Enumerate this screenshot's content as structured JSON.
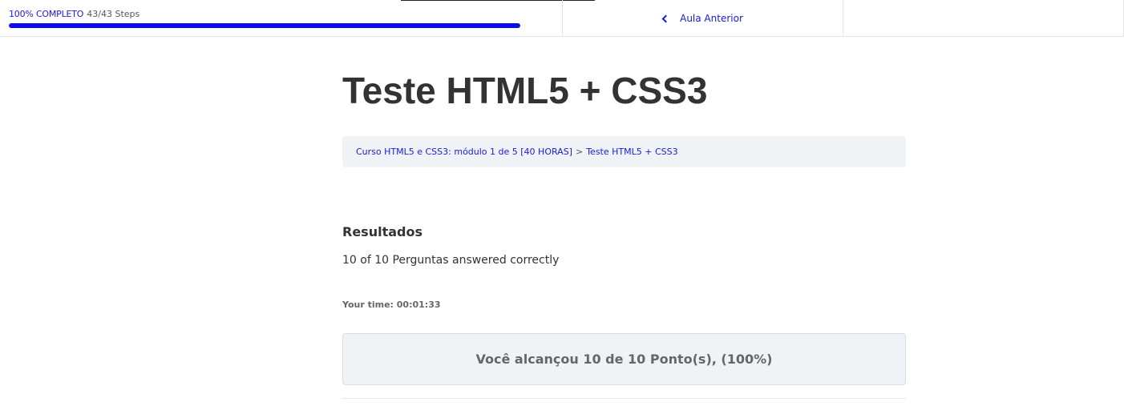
{
  "progress": {
    "percent_label": "100% COMPLETO",
    "steps_label": "43/43 Steps",
    "fraction": 1.0
  },
  "nav": {
    "prev_label": "Aula Anterior"
  },
  "page": {
    "title": "Teste HTML5 + CSS3"
  },
  "breadcrumb": {
    "course_label": "Curso HTML5 e CSS3: módulo 1 de 5 [40 HORAS]",
    "separator": ">",
    "current_label": "Teste HTML5 + CSS3"
  },
  "results": {
    "heading": "Resultados",
    "summary": "10 of 10 Perguntas answered correctly",
    "time": "Your time: 00:01:33",
    "points": "Você alcançou 10 de 10 Ponto(s), (100%)"
  },
  "colors": {
    "accent": "#1a1adb",
    "progress_fill": "#0b0bf0",
    "panel_bg": "#f0f3f6"
  },
  "icons": {
    "prev": "chevron-left-icon"
  }
}
